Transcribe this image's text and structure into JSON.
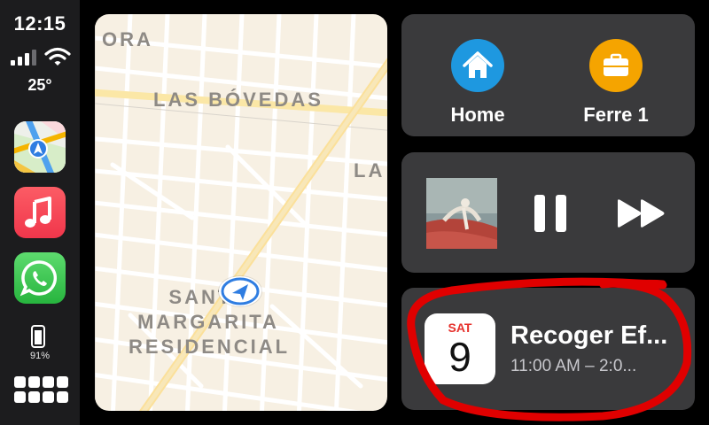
{
  "status": {
    "time": "12:15",
    "temperature": "25°",
    "battery": "91%",
    "signal_bars": 3,
    "signal_total": 4
  },
  "sidebar": {
    "apps": [
      {
        "name": "Maps",
        "icon": "maps-icon"
      },
      {
        "name": "Music",
        "icon": "music-icon"
      },
      {
        "name": "WhatsApp",
        "icon": "whatsapp-icon"
      }
    ]
  },
  "map": {
    "labels": {
      "ora": "ORA",
      "bovedas": "LAS BÓVEDAS",
      "la": "LA",
      "santa_line1": "SANTA",
      "santa_line2": "MARGARITA",
      "santa_line3": "RESIDENCIAL"
    }
  },
  "destinations": [
    {
      "label": "Home",
      "icon": "house-icon",
      "color": "#1e98e0"
    },
    {
      "label": "Ferre 1",
      "icon": "briefcase-icon",
      "color": "#f5a400"
    }
  ],
  "media": {
    "controls": [
      "pause-icon",
      "fast-forward-icon"
    ]
  },
  "calendar": {
    "day": "SAT",
    "date": "9",
    "title": "Recoger Ef...",
    "time": "11:00 AM – 2:0..."
  },
  "colors": {
    "card_bg": "#3a3a3c",
    "sidebar_bg": "#1c1c1e",
    "annotation": "#e00000"
  }
}
